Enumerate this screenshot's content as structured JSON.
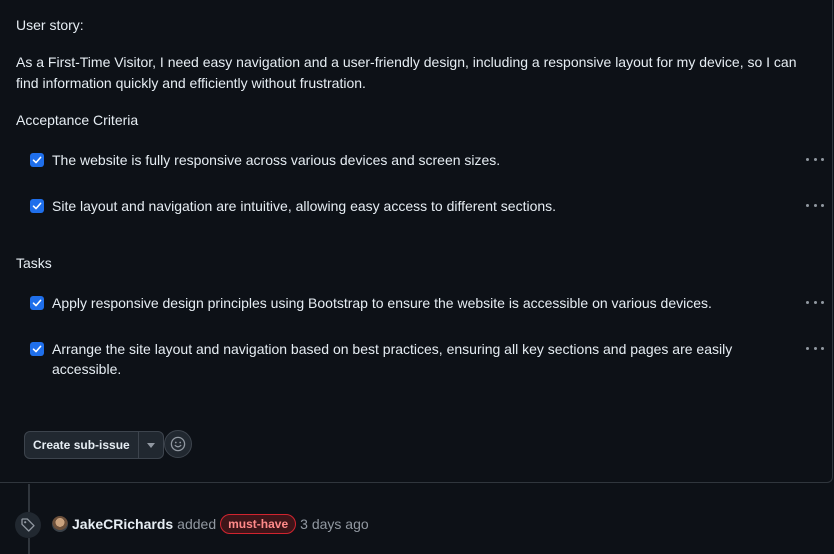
{
  "issue": {
    "story_heading": "User story:",
    "story_text": "As a First-Time Visitor, I need easy navigation and a user-friendly design, including a responsive layout for my device, so I can find information quickly and efficiently without frustration.",
    "acceptance_heading": "Acceptance Criteria",
    "acceptance_items": [
      {
        "text": "The website is fully responsive across various devices and screen sizes.",
        "checked": true
      },
      {
        "text": "Site layout and navigation are intuitive, allowing easy access to different sections.",
        "checked": true
      }
    ],
    "tasks_heading": "Tasks",
    "task_items": [
      {
        "text": "Apply responsive design principles using Bootstrap to ensure the website is accessible on various devices.",
        "checked": true
      },
      {
        "text": "Arrange the site layout and navigation based on best practices, ensuring all key sections and pages are easily accessible.",
        "checked": true
      }
    ]
  },
  "actions": {
    "create_sub_issue_label": "Create sub-issue",
    "caret_icon": "triangle-down-icon",
    "reaction_icon": "smiley-icon"
  },
  "timeline": {
    "event_icon": "tag-icon",
    "author": "JakeCRichards",
    "verb": "added",
    "label": "must-have",
    "label_color": "#d1242f",
    "time": "3 days ago"
  },
  "colors": {
    "background": "#0d1117",
    "checkbox": "#1f6feb",
    "text": "#e6edf3",
    "muted": "#9198a1"
  }
}
